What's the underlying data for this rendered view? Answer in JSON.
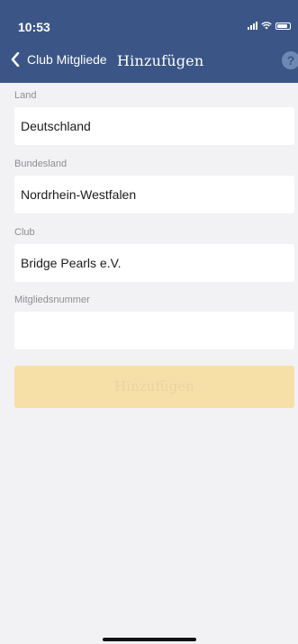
{
  "status_bar": {
    "time": "10:53"
  },
  "nav": {
    "back_label": "Club Mitgliede",
    "title": "Hinzufügen",
    "help_glyph": "?"
  },
  "form": {
    "fields": [
      {
        "label": "Land",
        "value": "Deutschland"
      },
      {
        "label": "Bundesland",
        "value": "Nordrhein-Westfalen"
      },
      {
        "label": "Club",
        "value": "Bridge Pearls e.V."
      },
      {
        "label": "Mitgliedsnummer",
        "value": ""
      }
    ],
    "submit_label": "Hinzufügen"
  },
  "colors": {
    "header_bg": "#3b5686",
    "button_bg": "#f7dfa8",
    "page_bg": "#f2f2f4"
  }
}
